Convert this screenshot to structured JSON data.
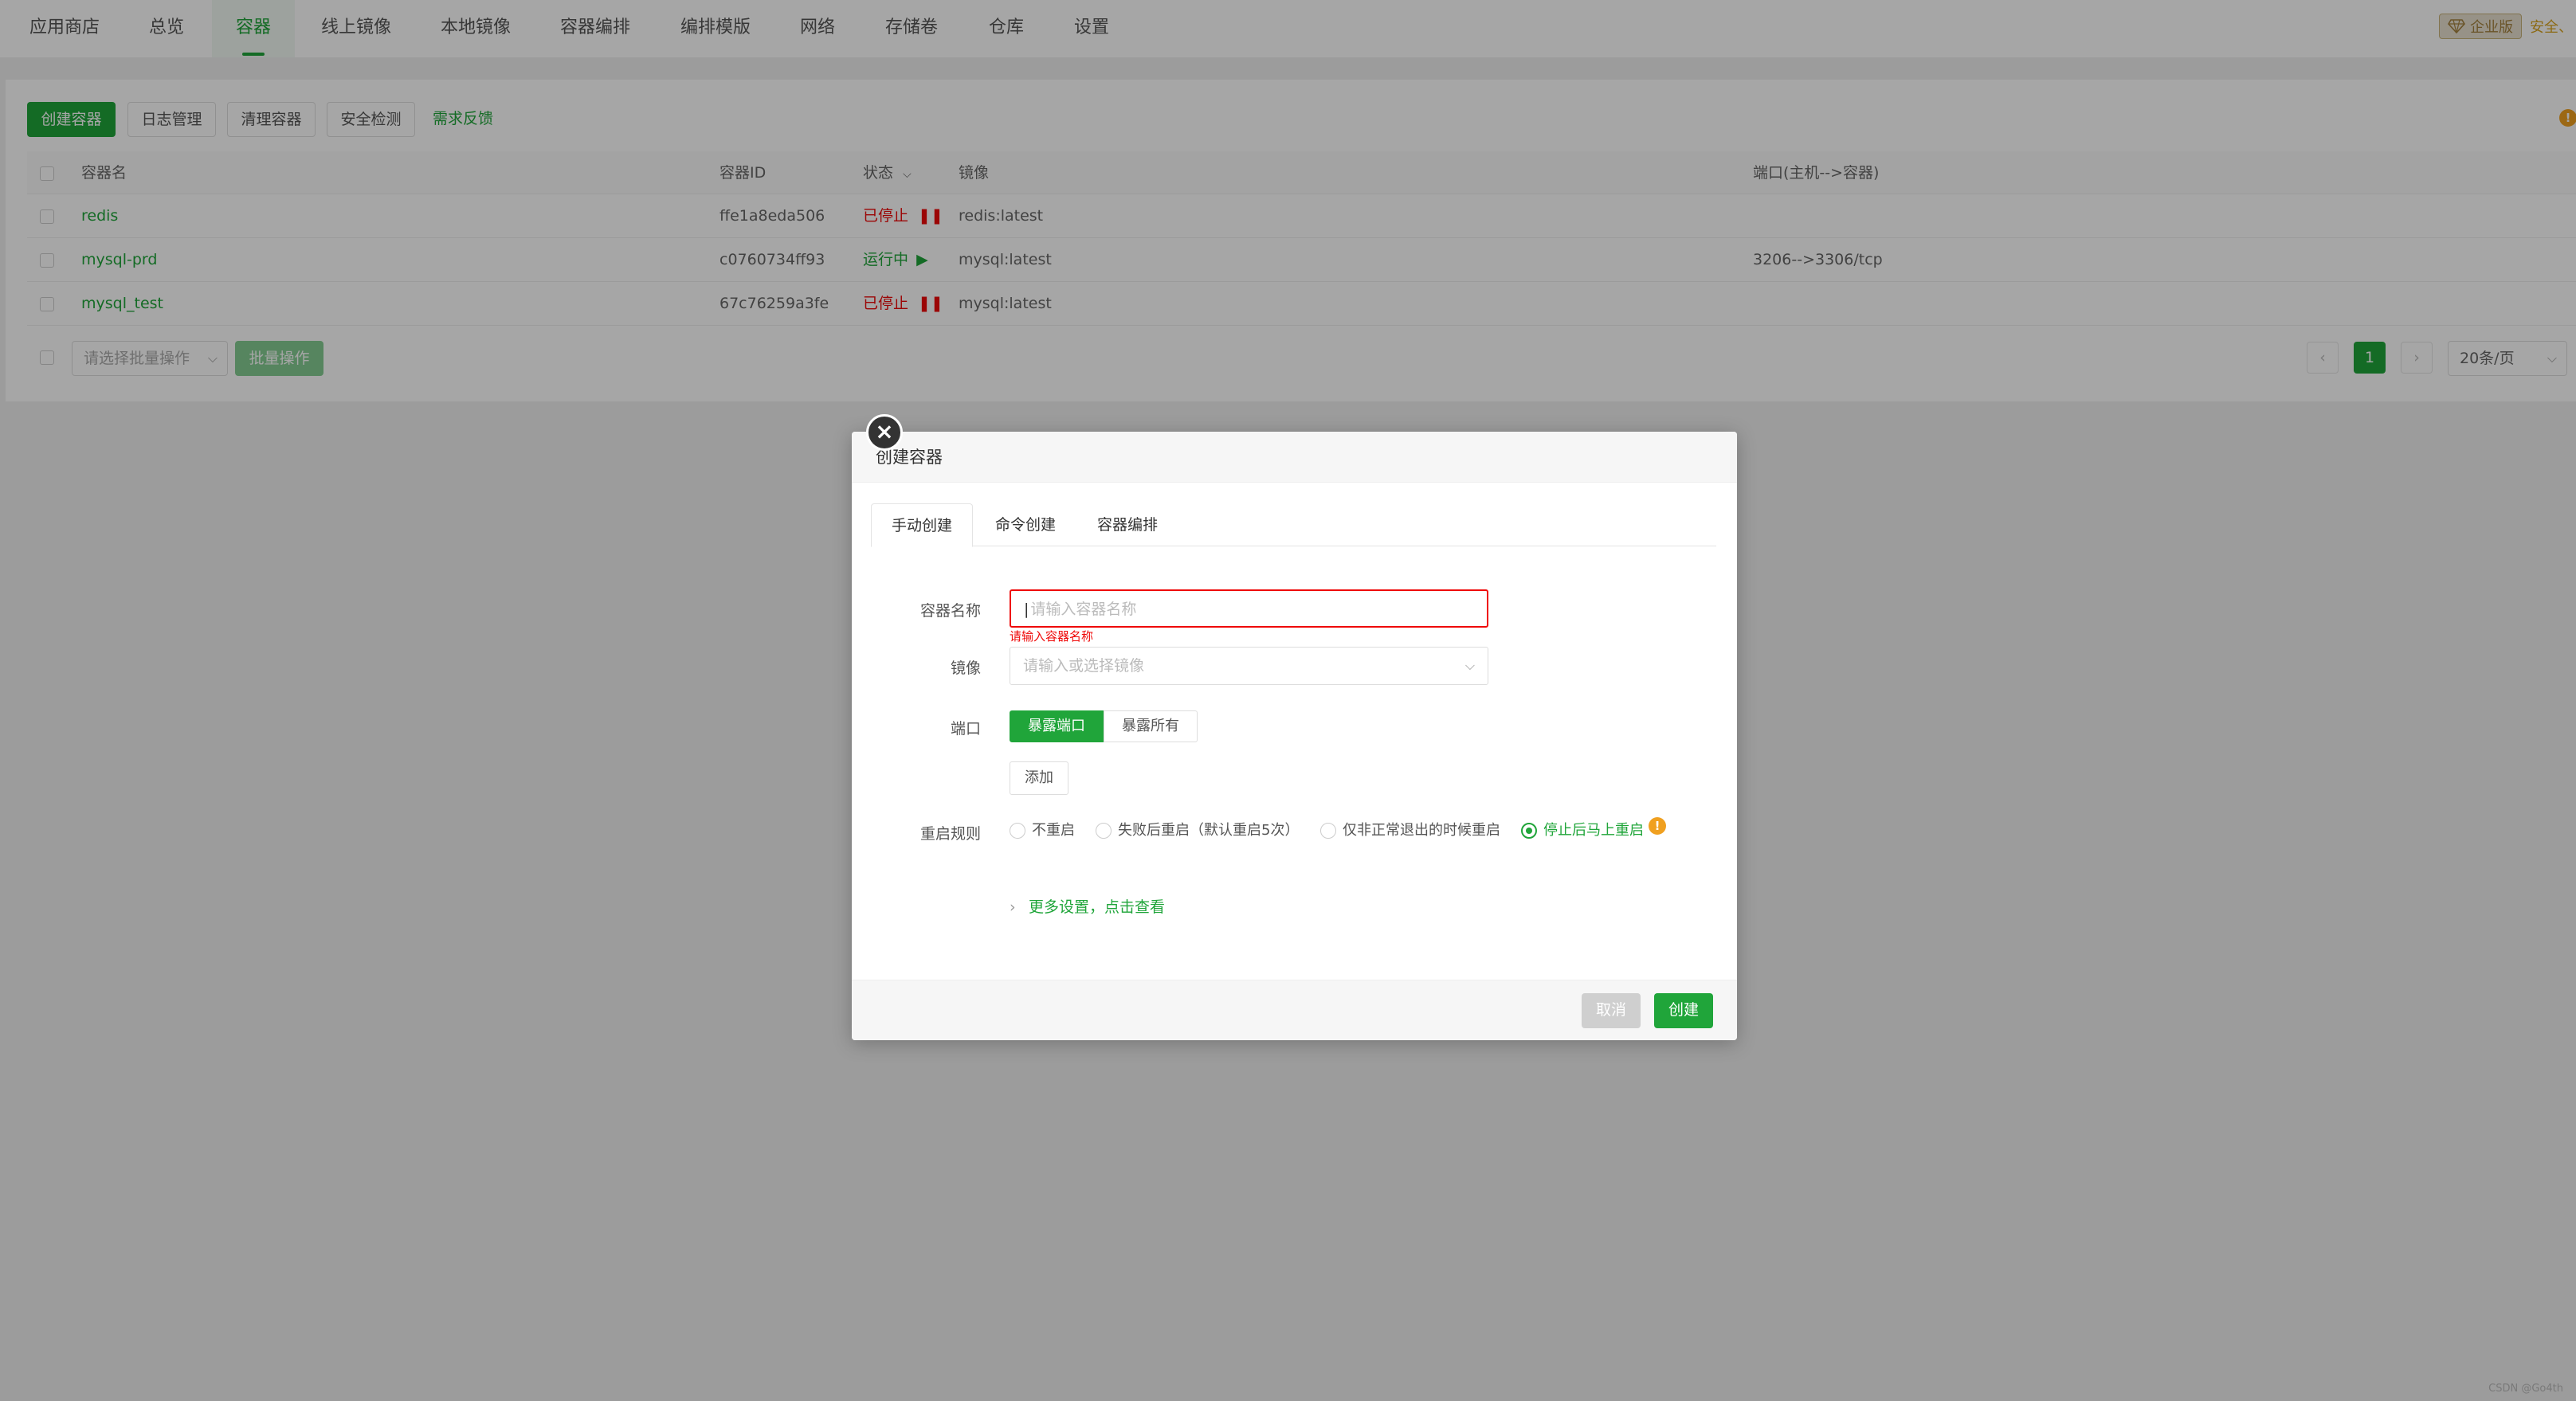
{
  "nav": {
    "items": [
      "应用商店",
      "总览",
      "容器",
      "线上镜像",
      "本地镜像",
      "容器编排",
      "编排模版",
      "网络",
      "存储卷",
      "仓库",
      "设置"
    ],
    "active": "容器",
    "enterprise_label": "企业版",
    "safety_label": "安全、"
  },
  "toolbar": {
    "create": "创建容器",
    "logs": "日志管理",
    "clean": "清理容器",
    "security": "安全检测",
    "feedback": "需求反馈"
  },
  "table": {
    "headers": {
      "name": "容器名",
      "id": "容器ID",
      "status": "状态",
      "image": "镜像",
      "ports": "端口(主机-->容器)"
    },
    "rows": [
      {
        "name": "redis",
        "id": "ffe1a8eda506",
        "status": "已停止",
        "status_icon": "pause-icon",
        "image": "redis:latest",
        "ports": ""
      },
      {
        "name": "mysql-prd",
        "id": "c0760734ff93",
        "status": "运行中",
        "status_icon": "play-icon",
        "image": "mysql:latest",
        "ports": "3206-->3306/tcp"
      },
      {
        "name": "mysql_test",
        "id": "67c76259a3fe",
        "status": "已停止",
        "status_icon": "pause-icon",
        "image": "mysql:latest",
        "ports": ""
      }
    ]
  },
  "batch": {
    "select_placeholder": "请选择批量操作",
    "button": "批量操作"
  },
  "pagination": {
    "current_page": "1",
    "page_size": "20条/页"
  },
  "modal": {
    "title": "创建容器",
    "tabs": [
      "手动创建",
      "命令创建",
      "容器编排"
    ],
    "active_tab": "手动创建",
    "name_label": "容器名称",
    "name_placeholder": "请输入容器名称",
    "name_error": "请输入容器名称",
    "image_label": "镜像",
    "image_placeholder": "请输入或选择镜像",
    "port_label": "端口",
    "port_options": [
      "暴露端口",
      "暴露所有"
    ],
    "port_selected": "暴露端口",
    "add_button": "添加",
    "restart_label": "重启规则",
    "restart_options": [
      "不重启",
      "失败后重启（默认重启5次）",
      "仅非正常退出的时候重启",
      "停止后马上重启"
    ],
    "restart_selected": "停止后马上重启",
    "more_settings": "更多设置，点击查看",
    "cancel": "取消",
    "confirm": "创建"
  },
  "watermark": "CSDN @Go4th",
  "colors": {
    "accent": "#20a53a",
    "danger": "#ef0808",
    "warning": "#f0a020"
  }
}
